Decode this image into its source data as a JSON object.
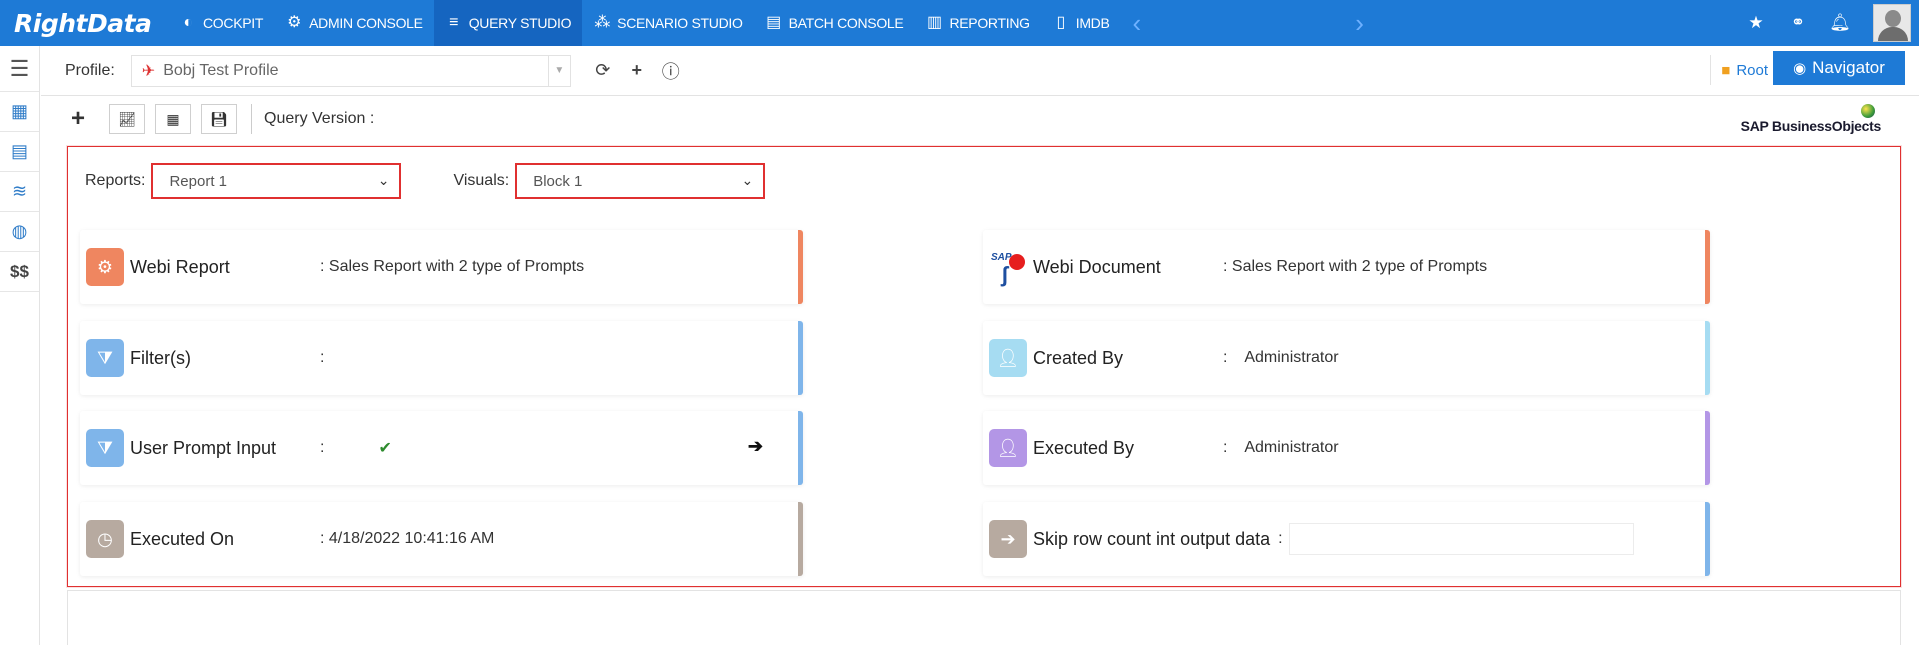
{
  "app": {
    "logo_text": "RightData"
  },
  "nav": {
    "items": [
      {
        "label": "COCKPIT",
        "icon": "dashboard-icon"
      },
      {
        "label": "ADMIN CONSOLE",
        "icon": "gear-icon"
      },
      {
        "label": "QUERY STUDIO",
        "icon": "database-icon",
        "active": true
      },
      {
        "label": "SCENARIO STUDIO",
        "icon": "scenario-icon"
      },
      {
        "label": "BATCH CONSOLE",
        "icon": "batch-icon"
      },
      {
        "label": "REPORTING",
        "icon": "report-icon"
      },
      {
        "label": "IMDB",
        "icon": "imdb-icon"
      }
    ],
    "right_icons": [
      "star-icon",
      "link-icon",
      "bell-icon",
      "user-avatar"
    ]
  },
  "profile": {
    "label": "Profile:",
    "selected": "Bobj Test Profile",
    "root_label": "Root",
    "navigator_label": "Navigator"
  },
  "toolbar": {
    "query_version_label": "Query Version :",
    "sap_logo_text": "SAP BusinessObjects"
  },
  "selectors": {
    "reports_label": "Reports:",
    "reports_value": "Report 1",
    "visuals_label": "Visuals:",
    "visuals_value": "Block 1"
  },
  "cards": {
    "webi_report": {
      "label": "Webi Report",
      "value": ": Sales Report with 2 type of Prompts",
      "color": "#ef8660"
    },
    "webi_document": {
      "label": "Webi Document",
      "value": ": Sales Report with 2 type of Prompts",
      "color": "#ef8660"
    },
    "filters": {
      "label": "Filter(s)",
      "value": ":",
      "color": "#7fb5ea"
    },
    "created_by": {
      "label": "Created By",
      "value": ":    Administrator",
      "color": "#a6dcf2"
    },
    "user_prompt": {
      "label": "User Prompt Input",
      "value": ":",
      "color": "#7fb5ea"
    },
    "executed_by": {
      "label": "Executed By",
      "value": ":    Administrator",
      "color": "#b396e6"
    },
    "executed_on": {
      "label": "Executed On",
      "value": ": 4/18/2022 10:41:16 AM",
      "color": "#b7aaa0"
    },
    "skip_row": {
      "label": "Skip row count int output data",
      "value": ":",
      "color": "#7fb5ea"
    }
  }
}
